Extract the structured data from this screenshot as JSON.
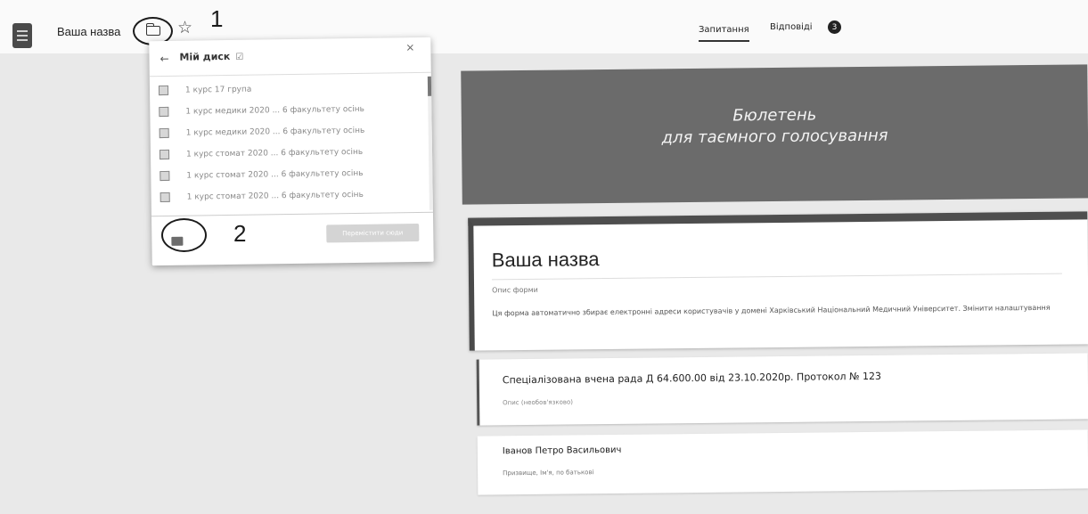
{
  "header": {
    "form_title": "Ваша назва",
    "annotation_1": "1",
    "tabs": [
      {
        "label": "Запитання"
      },
      {
        "label": "Відповіді",
        "badge": "3"
      }
    ]
  },
  "dialog": {
    "title": "Мій диск",
    "title_mark": "☑",
    "close": "×",
    "back": "←",
    "items": [
      {
        "name": "1 курс 17 група"
      },
      {
        "name": "1 курс медики 2020 ... 6 факультету осінь"
      },
      {
        "name": "1 курс медики 2020 ... 6 факультету осінь"
      },
      {
        "name": "1 курс стомат 2020 ... 6 факультету осінь"
      },
      {
        "name": "1 курс стомат 2020 ... 6 факультету осінь"
      },
      {
        "name": "1 курс стомат 2020 ... 6 факультету осінь"
      }
    ],
    "annotation_2": "2",
    "move_button": "Перемістити сюди"
  },
  "banner": {
    "line1": "Бюлетень",
    "line2": "для таємного голосування"
  },
  "title_card": {
    "form_name": "Ваша назва",
    "description_label": "Опис форми",
    "notice": "Ця форма автоматично збирає електронні адреси користувачів у домені Харківський Національний Медичний Університет.  Змінити налаштування"
  },
  "question_card": {
    "title": "Спеціалізована вчена рада Д 64.600.00 від 23.10.2020р. Протокол № 123",
    "description": "Опис (необов'язково)"
  },
  "answer_card": {
    "title": "Іванов Петро Васильович",
    "subtitle": "Призвище, Ім'я, по батькові"
  },
  "colors": {
    "banner": "#6b6b6b",
    "card_accent": "#4a4a4a"
  }
}
